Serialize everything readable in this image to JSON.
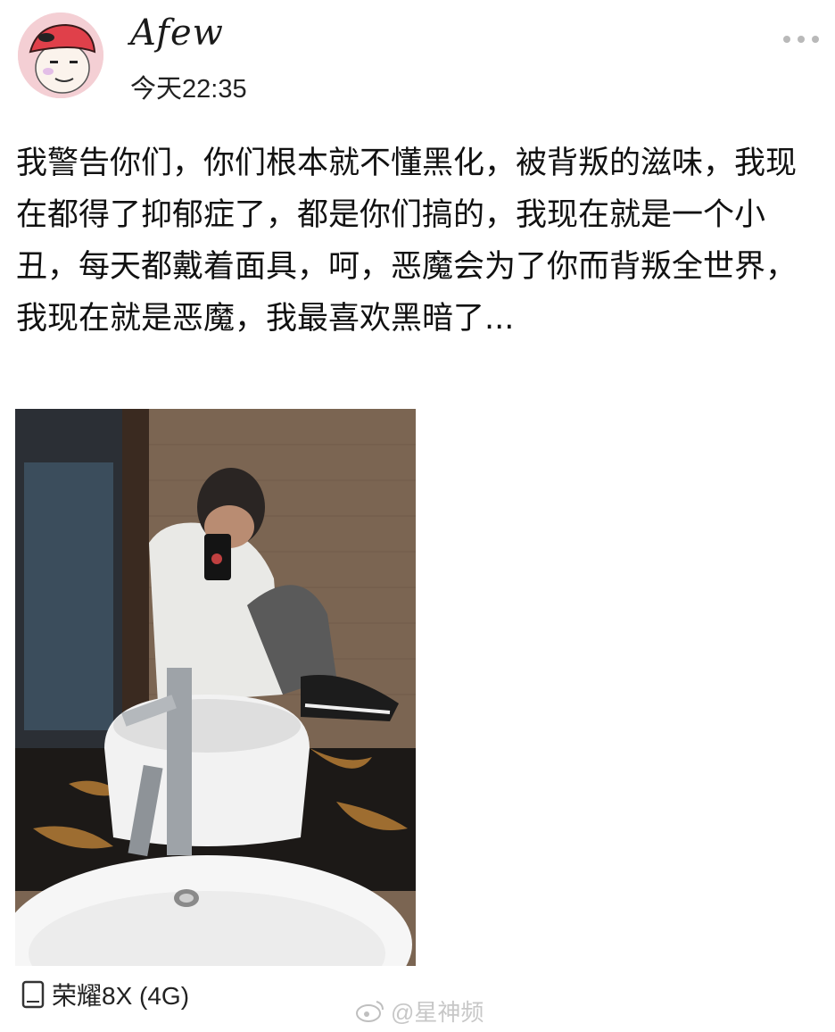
{
  "post": {
    "username": "Afew",
    "time": "今天22:35",
    "text": "我警告你们，你们根本就不懂黑化，被背叛的滋味，我现在都得了抑郁症了，都是你们搞的，我现在就是一个小丑，每天都戴着面具，呵，恶魔会为了你而背叛全世界，我现在就是恶魔，我最喜欢黑暗了...",
    "icons": {
      "avatar": "cartoon-face-avatar",
      "more": "more-dots-icon",
      "device": "phone-icon",
      "watermark": "weibo-logo-icon"
    },
    "device_label": "荣耀8X (4G)",
    "watermark_text": "@星神频"
  },
  "colors": {
    "background": "#ffffff",
    "text": "#111111",
    "muted": "#b9b9b9"
  }
}
